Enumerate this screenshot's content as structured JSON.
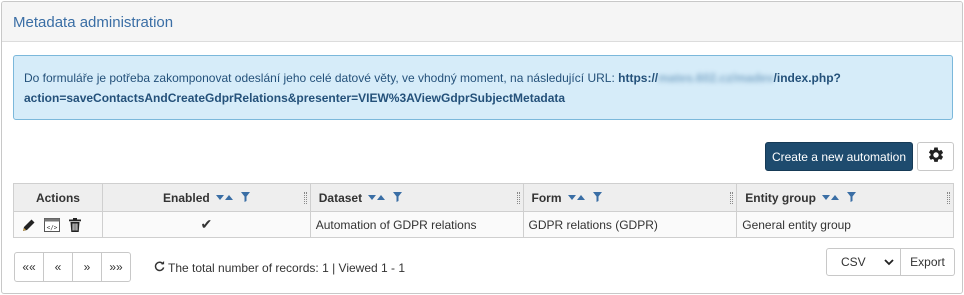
{
  "panel": {
    "title": "Metadata administration"
  },
  "info": {
    "text": "Do formuláře je potřeba zakomponovat odeslání jeho celé datové věty, ve vhodný moment, na následující URL: ",
    "url_prefix": "https://",
    "url_blurred": "mates.602.cz/madev",
    "url_suffix": "/index.php?",
    "url_line2": "action=saveContactsAndCreateGdprRelations&presenter=VIEW%3AViewGdprSubjectMetadata"
  },
  "toolbar": {
    "create_label": "Create a new automation",
    "settings_icon": "gear-icon"
  },
  "table": {
    "columns": [
      "Actions",
      "Enabled",
      "Dataset",
      "Form",
      "Entity group"
    ],
    "rows": [
      {
        "enabled": "✔",
        "dataset": "Automation of GDPR relations",
        "form": "GDPR relations (GDPR)",
        "entity_group": "General entity group"
      }
    ]
  },
  "pager": {
    "first": "««",
    "prev": "«",
    "next": "»",
    "last": "»»"
  },
  "records": {
    "text": "The total number of records: 1 | Viewed 1 - 1"
  },
  "export": {
    "format": "CSV",
    "label": "Export"
  },
  "colors": {
    "accent": "#1e4b6e",
    "title": "#3a6ea5",
    "info_bg": "#d6ecf9",
    "check": "#3a9a3a"
  }
}
